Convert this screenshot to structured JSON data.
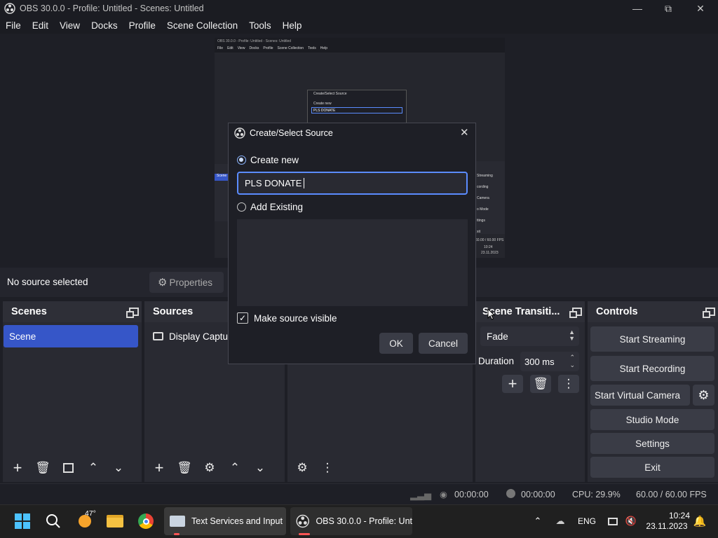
{
  "window": {
    "title": "OBS 30.0.0 - Profile: Untitled - Scenes: Untitled"
  },
  "menu": [
    "File",
    "Edit",
    "View",
    "Docks",
    "Profile",
    "Scene Collection",
    "Tools",
    "Help"
  ],
  "nested_preview": {
    "title": "OBS 30.0.0 - Profile: Untitled - Scenes: Untitled",
    "menu": [
      "File",
      "Edit",
      "View",
      "Docks",
      "Profile",
      "Scene Collection",
      "Tools",
      "Help"
    ],
    "dialog_title": "Create/Select Source",
    "create_new": "Create new",
    "value": "PLS DONATE",
    "scenes_label": "Scene",
    "fps": "60.00 / 60.00 FPS",
    "clock_time": "10:24",
    "clock_date": "23.11.2023",
    "controls": [
      "Streaming",
      "cording",
      "Camera",
      "o Mode",
      "ttings",
      "xit"
    ]
  },
  "context_bar": {
    "no_source": "No source selected",
    "properties": "Properties"
  },
  "scenes": {
    "header": "Scenes",
    "items": [
      "Scene"
    ]
  },
  "sources": {
    "header": "Sources",
    "items": [
      "Display Captu"
    ]
  },
  "transitions": {
    "header": "Scene Transiti...",
    "type": "Fade",
    "duration_label": "Duration",
    "duration": "300 ms"
  },
  "controls": {
    "header": "Controls",
    "start_streaming": "Start Streaming",
    "start_recording": "Start Recording",
    "virtual_camera": "Start Virtual Camera",
    "studio_mode": "Studio Mode",
    "settings": "Settings",
    "exit": "Exit"
  },
  "status": {
    "stream_time": "00:00:00",
    "record_time": "00:00:00",
    "cpu": "CPU: 29.9%",
    "fps": "60.00 / 60.00 FPS"
  },
  "dialog": {
    "title": "Create/Select Source",
    "create_new": "Create new",
    "name_value": "PLS DONATE",
    "add_existing": "Add Existing",
    "make_visible": "Make source visible",
    "ok": "OK",
    "cancel": "Cancel"
  },
  "taskbar": {
    "weather_temp": "47°",
    "task1": "Text Services and Input",
    "task2": "OBS 30.0.0 - Profile: Unt",
    "lang": "ENG",
    "time": "10:24",
    "date": "23.11.2023"
  },
  "colors": {
    "accent": "#3656c8",
    "focus": "#5b8cff",
    "bg": "#1e1f26",
    "dock": "#292a32",
    "button": "#3a3c46"
  }
}
